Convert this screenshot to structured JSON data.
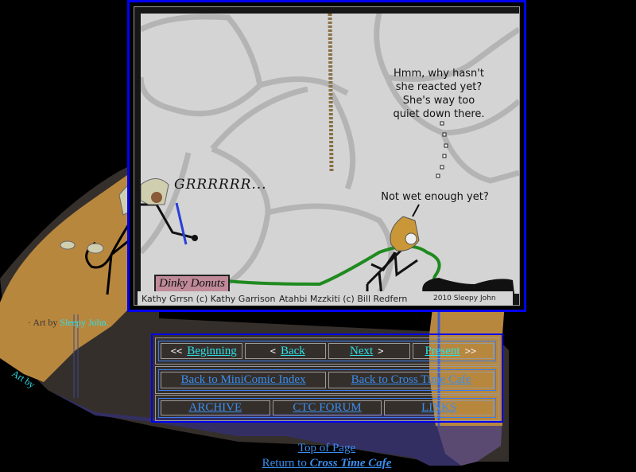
{
  "comic": {
    "speech_top": [
      "Hmm, why hasn't",
      "she reacted yet?",
      "She's way too",
      "quiet down there."
    ],
    "speech_bottom": "Not wet enough yet?",
    "growl": "GRRRRRR...",
    "shop_sign": "Dinky Donuts",
    "credits": {
      "character_1": "Kathy Grrsn (c) Kathy Garrison",
      "character_2": "Atahbi Mzzkiti (c) Bill Redfern",
      "artist_credit": "2010 Sleepy John"
    }
  },
  "art_by": {
    "prefix": "· Art by ",
    "artist": "Sleepy John.",
    "rotated_label": "Art by"
  },
  "nav": {
    "row1": [
      {
        "pre": "<<",
        "label": "Beginning",
        "post": ""
      },
      {
        "pre": "<",
        "label": "Back",
        "post": ""
      },
      {
        "pre": "",
        "label": "Next",
        "post": ">"
      },
      {
        "pre": "",
        "label": "Present",
        "post": ">>"
      }
    ],
    "row2": [
      "Back to MiniComic Index",
      "Back to Cross Time Cafe"
    ],
    "row3": [
      "ARCHIVE",
      "CTC FORUM",
      "LINKS"
    ]
  },
  "footer": {
    "top_of_page": "Top of Page",
    "return_prefix": "Return to ",
    "return_site": "Cross Time Cafe"
  },
  "colors": {
    "frame_blue": "#0000f0",
    "link_cyan": "#2ce0e6",
    "link_blue": "#3a8ef0",
    "tan": "#b8873e",
    "shadow": "#352f2b",
    "purple": "#332f63"
  }
}
